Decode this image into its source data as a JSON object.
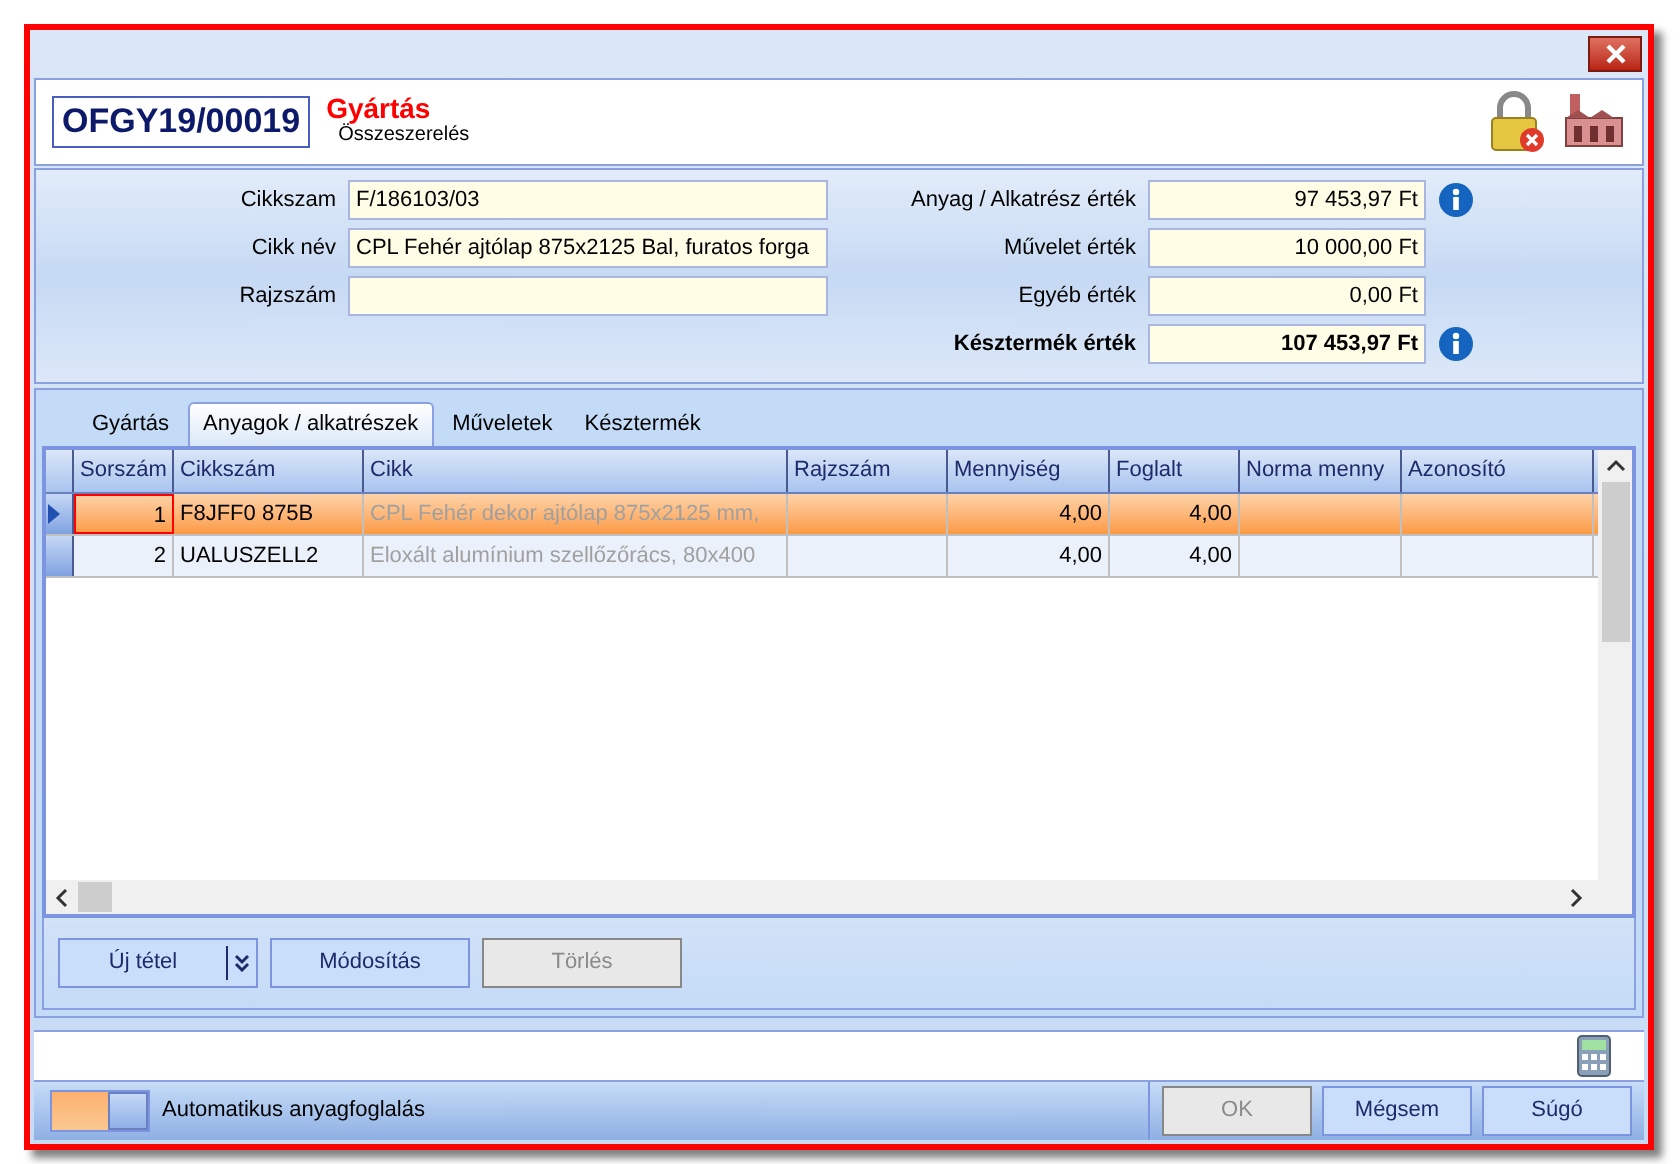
{
  "header": {
    "document_number": "OFGY19/00019",
    "title": "Gyártás",
    "subtitle": "Összeszerelés"
  },
  "fields_left": [
    {
      "label": "Cikkszam",
      "value": "F/186103/03"
    },
    {
      "label": "Cikk név",
      "value": "CPL Fehér ajtólap 875x2125 Bal, furatos forga"
    },
    {
      "label": "Rajzszám"
    }
  ],
  "fields_right": [
    {
      "label": "Anyag / Alkatrész érték",
      "value": "97 453,97 Ft",
      "info": true,
      "bold": false
    },
    {
      "label": "Művelet érték",
      "value": "10 000,00 Ft",
      "info": false,
      "bold": false
    },
    {
      "label": "Egyéb érték",
      "value": "0,00 Ft",
      "info": false,
      "bold": false
    },
    {
      "label": "Késztermék érték",
      "value": "107 453,97 Ft",
      "info": true,
      "bold": true
    }
  ],
  "tabs": [
    {
      "label": "Gyártás",
      "selected": false
    },
    {
      "label": "Anyagok / alkatrészek",
      "selected": true
    },
    {
      "label": "Műveletek",
      "selected": false
    },
    {
      "label": "Késztermék",
      "selected": false
    }
  ],
  "table": {
    "columns": [
      "Sorszám",
      "Cikkszám",
      "Cikk",
      "Rajzszám",
      "Mennyiség",
      "Foglalt",
      "Norma menny",
      "Azonosító"
    ],
    "rows": [
      {
        "selected": true,
        "cells": [
          "1",
          "F8JFF0 875B",
          "CPL Fehér dekor ajtólap 875x2125 mm,",
          null,
          "4,00",
          "4,00",
          null,
          null
        ]
      },
      {
        "selected": false,
        "cells": [
          "2",
          "UALUSZELL2",
          "Eloxált alumínium szellőzőrács, 80x400",
          null,
          "4,00",
          "4,00",
          null,
          null
        ]
      }
    ]
  },
  "actions": [
    {
      "label": "Új tétel",
      "kind": "split",
      "disabled": false
    },
    {
      "label": "Módosítás",
      "kind": "plain",
      "disabled": false
    },
    {
      "label": "Törlés",
      "kind": "plain",
      "disabled": true
    }
  ],
  "auto_reserve": {
    "label": "Automatikus anyagfoglalás",
    "on": true
  },
  "buttons": [
    {
      "label": "OK",
      "disabled": true
    },
    {
      "label": "Mégsem",
      "disabled": false
    },
    {
      "label": "Súgó",
      "disabled": false
    }
  ]
}
